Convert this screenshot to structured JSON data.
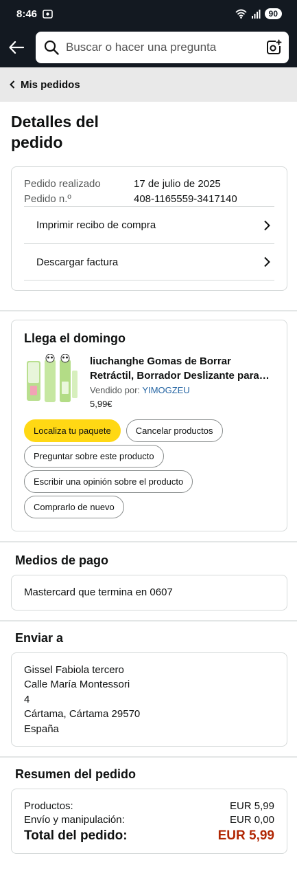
{
  "status": {
    "time": "8:46",
    "battery": "90"
  },
  "search": {
    "placeholder": "Buscar o hacer una pregunta"
  },
  "breadcrumb": {
    "label": "Mis pedidos"
  },
  "page_title": "Detalles del pedido",
  "order": {
    "placed_label": "Pedido realizado",
    "placed_value": "17 de julio de 2025",
    "number_label": "Pedido n.º",
    "number_value": "408-1165559-3417140",
    "links": [
      "Imprimir recibo de compra",
      "Descargar factura"
    ]
  },
  "shipment": {
    "title": "Llega el domingo",
    "item_name": "liuchanghe Gomas de Borrar Retráctil, Borrador Deslizante para Niños",
    "seller_label": "Vendido por:",
    "seller_name": "YIMOGZEU",
    "price": "5,99€",
    "buttons": [
      "Localiza tu paquete",
      "Cancelar productos",
      "Preguntar sobre este producto",
      "Escribir una opinión sobre el producto",
      "Comprarlo de nuevo"
    ]
  },
  "payment": {
    "title": "Medios de pago",
    "method": "Mastercard  que termina en 0607"
  },
  "shipping": {
    "title": "Enviar a",
    "lines": [
      "Gissel Fabiola tercero",
      "Calle María Montessori",
      "4",
      "Cártama, Cártama 29570",
      "España"
    ]
  },
  "summary": {
    "title": "Resumen del pedido",
    "products_label": "Productos:",
    "products_value": "EUR 5,99",
    "shipping_label": "Envío y manipulación:",
    "shipping_value": "EUR 0,00",
    "total_label": "Total del pedido:",
    "total_value": "EUR 5,99"
  },
  "colors": {
    "header_bg": "#131921",
    "primary_button": "#ffd814",
    "total_price": "#b12704",
    "seller_link": "#2162a1"
  }
}
